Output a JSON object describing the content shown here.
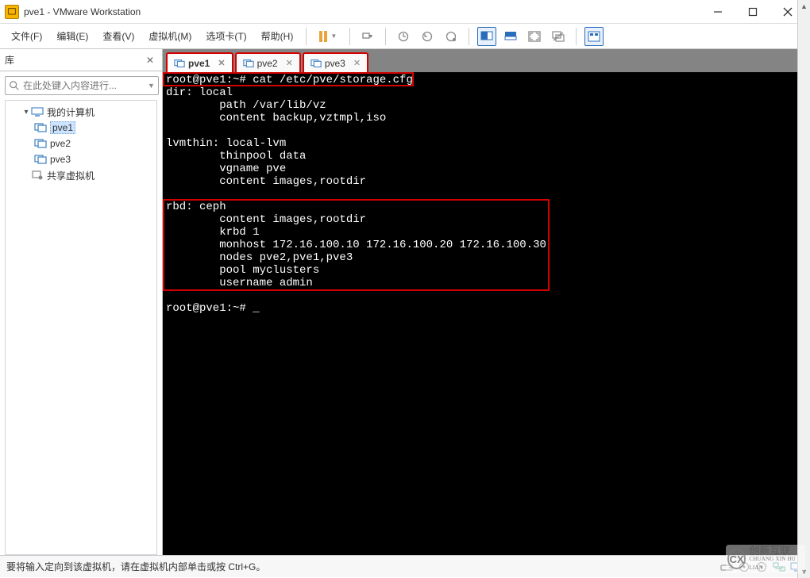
{
  "window": {
    "title": "pve1 - VMware Workstation"
  },
  "menus": {
    "file": "文件(F)",
    "edit": "编辑(E)",
    "view": "查看(V)",
    "vm": "虚拟机(M)",
    "tabs": "选项卡(T)",
    "help": "帮助(H)"
  },
  "sidebar": {
    "title": "库",
    "search_placeholder": "在此处键入内容进行...",
    "nodes": {
      "root": "我的计算机",
      "vm1": "pve1",
      "vm2": "pve2",
      "vm3": "pve3",
      "shared": "共享虚拟机"
    }
  },
  "tabs": [
    {
      "label": "pve1",
      "active": true
    },
    {
      "label": "pve2",
      "active": false
    },
    {
      "label": "pve3",
      "active": false
    }
  ],
  "terminal": {
    "cmd_line": "root@pve1:~# cat /etc/pve/storage.cfg",
    "body": "dir: local\n        path /var/lib/vz\n        content backup,vztmpl,iso\n\nlvmthin: local-lvm\n        thinpool data\n        vgname pve\n        content images,rootdir\n\nrbd: ceph\n        content images,rootdir\n        krbd 1\n        monhost 172.16.100.10 172.16.100.20 172.16.100.30\n        nodes pve2,pve1,pve3\n        pool myclusters\n        username admin\n\nroot@pve1:~# _"
  },
  "statusbar": {
    "text": "要将输入定向到该虚拟机，请在虚拟机内部单击或按 Ctrl+G。"
  },
  "watermark": {
    "brand": "创新互联",
    "sub": "CHUANG XIN HU LIAN"
  }
}
